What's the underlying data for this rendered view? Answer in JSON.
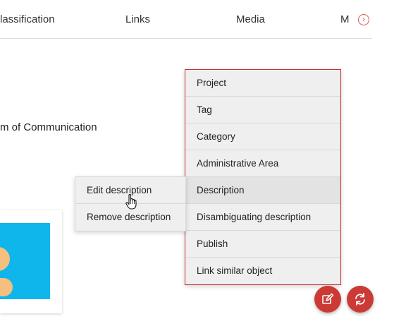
{
  "tabs": [
    {
      "label": "lassification"
    },
    {
      "label": "Links"
    },
    {
      "label": "Media"
    },
    {
      "label": "M"
    }
  ],
  "content": {
    "text": "m of Communication"
  },
  "context_menu": {
    "items": [
      {
        "label": "Project"
      },
      {
        "label": "Tag"
      },
      {
        "label": "Category"
      },
      {
        "label": "Administrative Area"
      },
      {
        "label": "Description"
      },
      {
        "label": "Disambiguating description"
      },
      {
        "label": "Publish"
      },
      {
        "label": "Link similar object"
      }
    ]
  },
  "submenu": {
    "items": [
      {
        "label": "Edit description"
      },
      {
        "label": "Remove description"
      }
    ]
  },
  "colors": {
    "accent": "#cc3a35",
    "card_image": "#0fb6ec"
  },
  "icons": {
    "tabs_next": "chevron-right-circle-icon",
    "fab_edit": "edit-icon",
    "fab_sync": "sync-icon",
    "pointer": "hand-pointer-icon"
  }
}
